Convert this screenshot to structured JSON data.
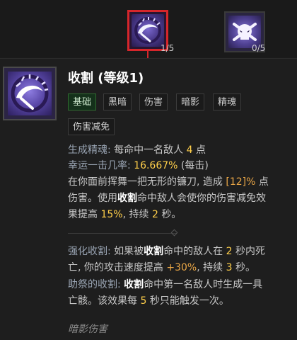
{
  "top_slots": [
    {
      "count": "1/5",
      "icon": "reap-scythe-icon"
    },
    {
      "count": "0/5",
      "icon": "bone-cross-icon"
    }
  ],
  "skill": {
    "title": "收割 (等级1)",
    "icon": "reap-scythe-icon",
    "tags": [
      "基础",
      "黑暗",
      "伤害",
      "暗影",
      "精魂",
      "伤害减免"
    ]
  },
  "stats": {
    "essence_label": "生成精魂:",
    "essence_text_a": "每命中一名敌人",
    "essence_value": "4",
    "essence_text_b": "点",
    "lucky_label": "幸运一击几率:",
    "lucky_value": "16.667%",
    "lucky_suffix": "(每击)"
  },
  "description": {
    "line1_a": "在你面前挥舞一把无形的镰刀, 造成",
    "line1_value": "[12]%",
    "line1_b": "点",
    "line2_a": "伤害。使用",
    "line2_bold": "收割",
    "line2_b": "命中敌人会使你的伤害减免效",
    "line3_a": "果提高",
    "line3_value": "15%",
    "line3_b": ", 持续",
    "line3_seconds": "2",
    "line3_c": "秒。"
  },
  "enhancements": {
    "enhanced_label": "强化收割:",
    "enhanced_a": "如果被",
    "enhanced_bold": "收割",
    "enhanced_b": "命中的敌人在",
    "enhanced_seconds": "2",
    "enhanced_c": "秒内死",
    "enhanced_line2_a": "亡, 你的攻击速度提高",
    "enhanced_value": "+30%",
    "enhanced_line2_b": ", 持续",
    "enhanced_duration": "3",
    "enhanced_line2_c": "秒。",
    "acolyte_label": "助祭的收割:",
    "acolyte_bold": "收割",
    "acolyte_a": "命中第一名敌人时生成一具",
    "acolyte_line2_a": "亡骸。该效果每",
    "acolyte_value": "5",
    "acolyte_line2_b": "秒只能触发一次。"
  },
  "footer": "暗影伤害"
}
